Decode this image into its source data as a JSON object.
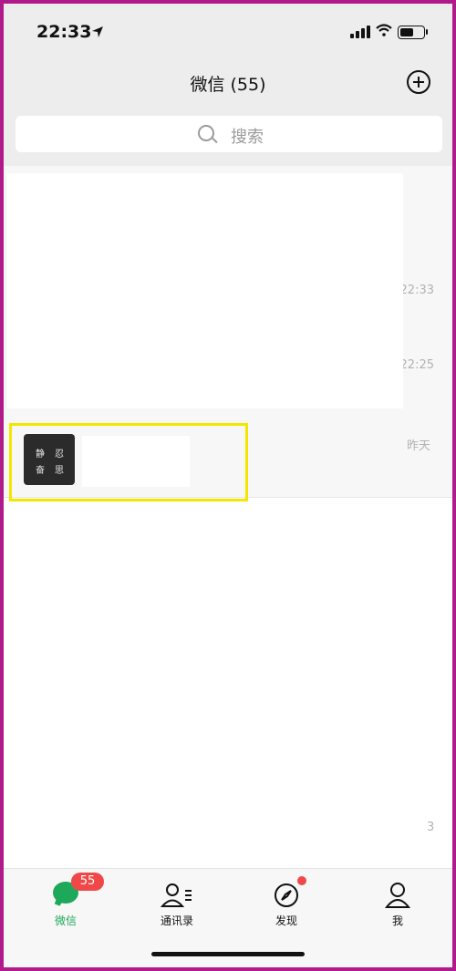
{
  "status_bar": {
    "time": "22:33"
  },
  "navbar": {
    "title": "微信 (55)"
  },
  "search": {
    "placeholder": "搜索"
  },
  "chat_rows": [
    {
      "time": "22:33"
    },
    {
      "time": "22:25"
    },
    {
      "avatar_text": [
        "静",
        "忍",
        "奋",
        "思"
      ],
      "time": "昨天"
    },
    {
      "time": "3"
    }
  ],
  "tabbar": {
    "tabs": [
      {
        "label": "微信",
        "badge": "55",
        "icon": "chat-icon",
        "active": true
      },
      {
        "label": "通讯录",
        "icon": "contacts-icon"
      },
      {
        "label": "发现",
        "icon": "compass-icon",
        "dot": true
      },
      {
        "label": "我",
        "icon": "profile-icon"
      }
    ]
  },
  "colors": {
    "accent_green": "#1ea85a",
    "badge_red": "#f04848",
    "highlight_yellow": "#f5e600",
    "frame_magenta": "#b01a8a"
  }
}
